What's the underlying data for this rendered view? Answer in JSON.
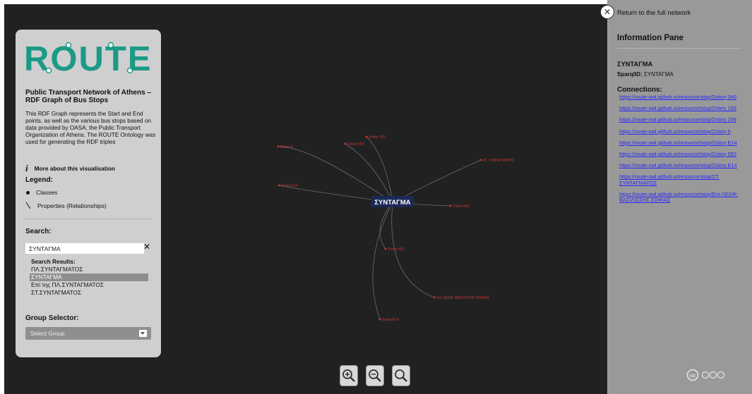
{
  "left_panel": {
    "logo_text": "ROUTE",
    "title": "Public Transport Network of Athens – RDF Graph of Bus Stops",
    "description": "This RDF Graph represents the Start and End points, as well as the various bus stops based on data provided by OASA, the Public Transport Organization of Athens. The ROUTE Ontology was used for generating the RDF triples",
    "more_label": "More about this visualisation",
    "more_icon": "info-icon",
    "legend_title": "Legend:",
    "legend_classes": "Classes",
    "legend_properties": "Properties (Relationships)",
    "search_title": "Search:",
    "search_value": "ΣΥΝΤΑΓΜΑ",
    "search_results_title": "Search Results:",
    "search_results": [
      "ΠΛ.ΣΥΝΤΑΓΜΑΤΟΣ",
      "ΣΥΝΤΑΓΜΑ",
      "Επί της ΠΛ.ΣΥΝΤΑΓΜΑΤΟΣ",
      "ΣΤ.ΣΥΝΤΑΓΜΑΤΟΣ"
    ],
    "selected_result": "ΣΥΝΤΑΓΜΑ",
    "group_title": "Group Selector:",
    "group_value": "Select Group"
  },
  "graph": {
    "center_label": "ΣΥΝΤΑΓΜΑ",
    "node_labels": [
      "Στάση 5",
      "Στάση 209",
      "Στάση 165",
      "ΣΤ. ΣΥΝΤΑΓΜΑΤΟΣ",
      "Στάση Ε14",
      "Στάση 040",
      "Στάση 550",
      "Επί ΛΕΩΦ. ΒΑΣΙΛΙΣΣΗΣ ΣΟΦΙΑΣ",
      "Στάση Ε14"
    ],
    "node_color": "#c93a3a",
    "center_color": "#1b2a55"
  },
  "zoom": {
    "in_icon": "zoom-in-icon",
    "out_icon": "zoom-out-icon",
    "reset_icon": "zoom-reset-icon"
  },
  "right_panel": {
    "return_label": "Return to the full network",
    "title": "Information Pane",
    "node_name": "ΣΥΝΤΑΓΜΑ",
    "sparql_label": "SparqlID:",
    "sparql_value": "ΣΥΝΤΑΓΜΑ",
    "connections_title": "Connections:",
    "connections": [
      "https://route-owl.github.io/resource/stop/Στάση 040",
      "https://route-owl.github.io/resource/stop/Στάση 165",
      "https://route-owl.github.io/resource/stop/Στάση 209",
      "https://route-owl.github.io/resource/stop/Στάση 5",
      "https://route-owl.github.io/resource/stop/Στάση Ε14",
      "https://route-owl.github.io/resource/stop/Στάση 550",
      "https://route-owl.github.io/resource/stop/Στάση Ε14",
      "https://route-owl.github.io/resource/stop/ΣΤ. ΣΥΝΤΑΓΜΑΤΟΣ",
      "https://route-owl.github.io/resource/stop/Επί ΛΕΩΦ. ΒΑΣΙΛΙΣΣΗΣ ΣΟΦΙΑΣ"
    ],
    "link_color": "#2626ff"
  }
}
